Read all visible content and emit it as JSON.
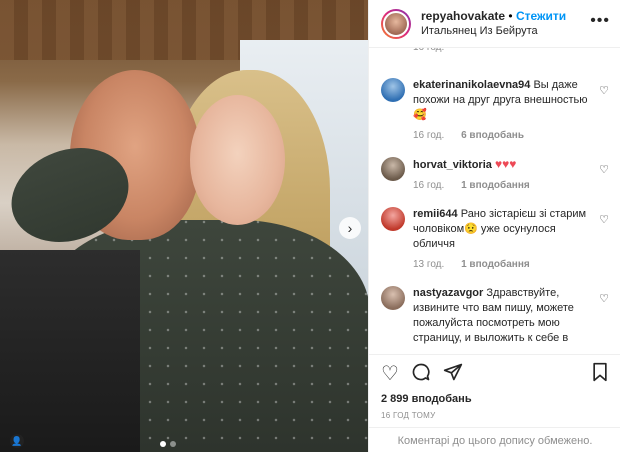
{
  "post": {
    "username": "repyahovakate",
    "follow_separator": "•",
    "follow_label": "Стежити",
    "location": "Итальянец Из Бейрута",
    "more_icon": "more-icon"
  },
  "comments": [
    {
      "meta_time": "16 год.",
      "partial": true
    },
    {
      "user": "ekaterinanikolaevna94",
      "text": "Вы даже похожи на друг друга внешностью🥰",
      "time": "16 год.",
      "likes": "6 вподобань",
      "avatar_color": "#2f6fb3"
    },
    {
      "user": "horvat_viktoria",
      "text": "♥♥♥",
      "time": "16 год.",
      "likes": "1 вподобання",
      "avatar_color": "#6b5a4a"
    },
    {
      "user": "remii644",
      "text": "Рано зістарієш зі старим чоловіком😟 уже осунулося обличчя",
      "time": "13 год.",
      "likes": "1 вподобання",
      "avatar_color": "#c0392b"
    },
    {
      "user": "nastyazavgor",
      "text": "Здравствуйте, извините что вам пишу, можете пожалуйста посмотреть мою страницу, и выложить к себе в",
      "avatar_color": "#8a6d5c"
    }
  ],
  "actions": {
    "likes": "2 899 вподобань",
    "time": "16 ГОД ТОМУ",
    "comments_disabled": "Коментарі до цього допису обмежено."
  },
  "carousel": {
    "slides": 2,
    "active": 1
  }
}
